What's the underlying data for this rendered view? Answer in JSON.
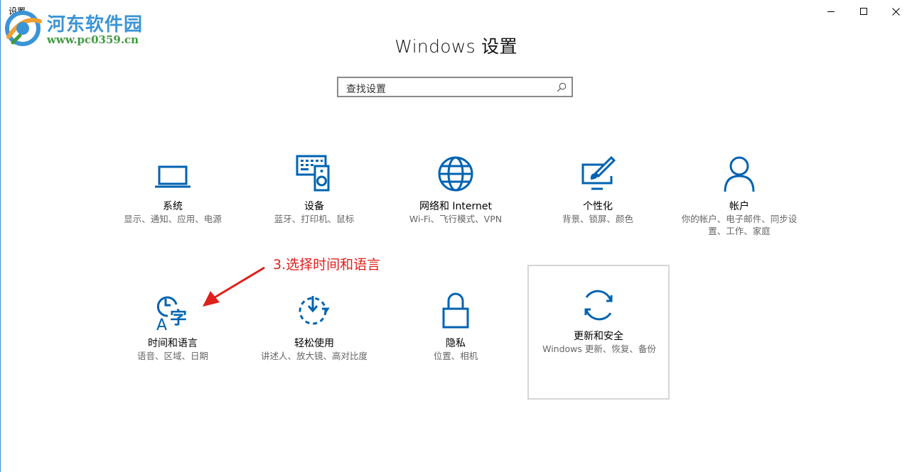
{
  "window": {
    "title": "设置",
    "minimize_icon": "minimize-icon",
    "maximize_icon": "maximize-icon",
    "close_icon": "close-icon"
  },
  "watermark": {
    "name": "河东软件园",
    "url": "www.pc0359.cn"
  },
  "header": {
    "title": "Windows 设置"
  },
  "search": {
    "placeholder": "查找设置",
    "icon": "search-icon"
  },
  "tiles": [
    {
      "label": "系统",
      "desc": "显示、通知、应用、电源",
      "icon": "laptop-icon"
    },
    {
      "label": "设备",
      "desc": "蓝牙、打印机、鼠标",
      "icon": "keyboard-speaker-icon"
    },
    {
      "label": "网络和 Internet",
      "desc": "Wi-Fi、飞行模式、VPN",
      "icon": "globe-icon"
    },
    {
      "label": "个性化",
      "desc": "背景、锁屏、颜色",
      "icon": "paint-screen-icon"
    },
    {
      "label": "帐户",
      "desc": "你的帐户、电子邮件、同步设置、工作、家庭",
      "icon": "person-icon"
    },
    {
      "label": "时间和语言",
      "desc": "语音、区域、日期",
      "icon": "time-language-icon"
    },
    {
      "label": "轻松使用",
      "desc": "讲述人、放大镜、高对比度",
      "icon": "ease-of-access-icon"
    },
    {
      "label": "隐私",
      "desc": "位置、相机",
      "icon": "lock-icon"
    },
    {
      "label": "更新和安全",
      "desc": "Windows 更新、恢复、备份",
      "icon": "refresh-icon"
    }
  ],
  "annotation": {
    "text": "3.选择时间和语言"
  },
  "colors": {
    "accent": "#0063b1",
    "annotation": "#e0201a",
    "watermark_blue": "#3b94d6",
    "watermark_green": "#3f9a3f"
  }
}
